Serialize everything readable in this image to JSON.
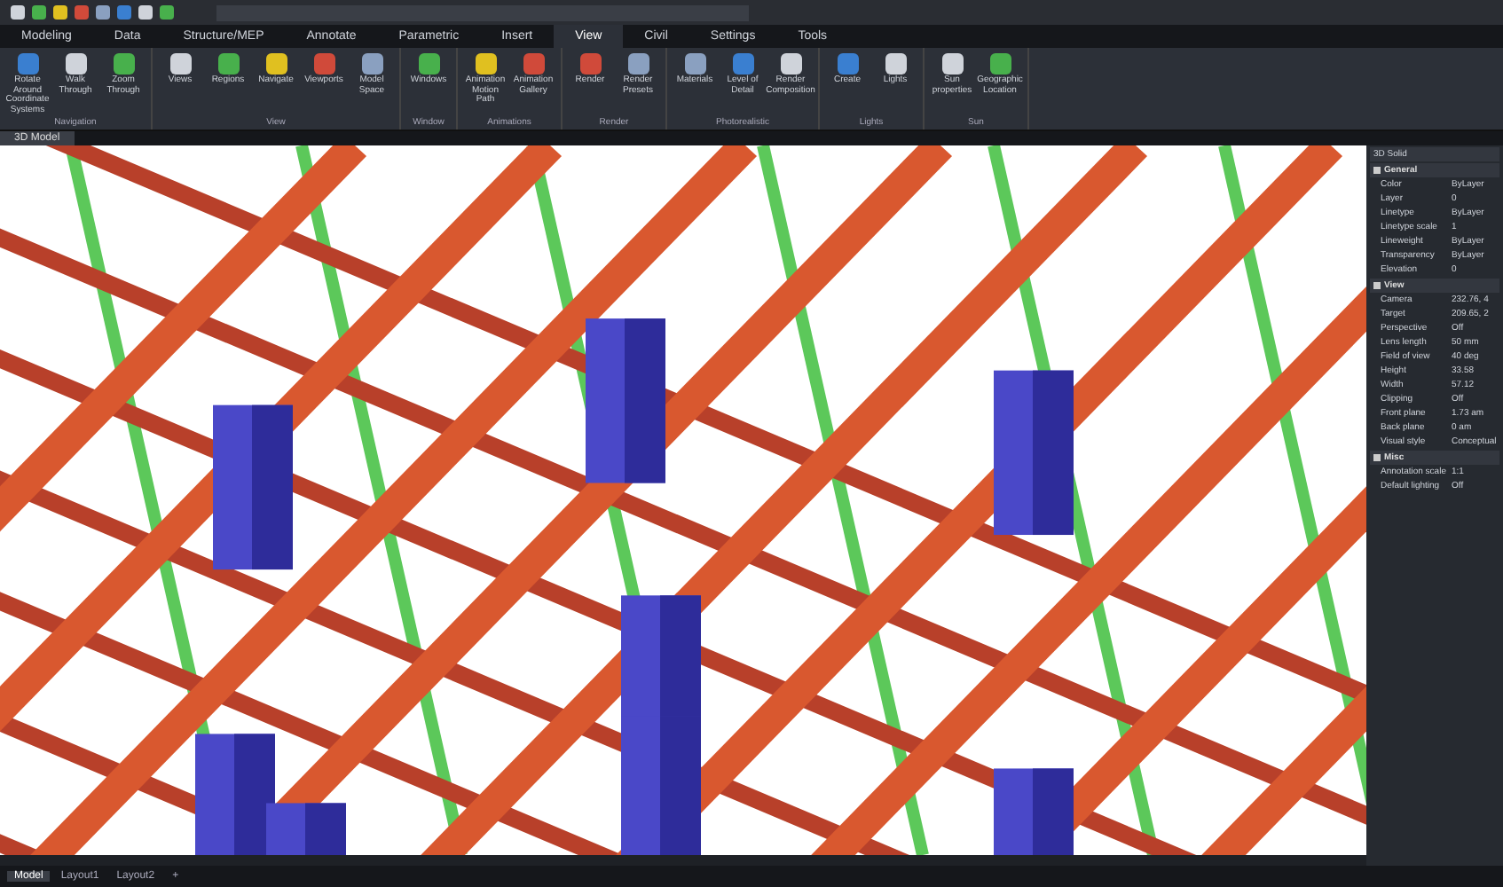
{
  "ribbon_tabs": [
    {
      "label": "Modeling",
      "selected": false
    },
    {
      "label": "Data",
      "selected": false
    },
    {
      "label": "Structure/MEP",
      "selected": false
    },
    {
      "label": "Annotate",
      "selected": false
    },
    {
      "label": "Parametric",
      "selected": false
    },
    {
      "label": "Insert",
      "selected": false
    },
    {
      "label": "View",
      "selected": true
    },
    {
      "label": "Civil",
      "selected": false
    },
    {
      "label": "Settings",
      "selected": false
    },
    {
      "label": "Tools",
      "selected": false
    }
  ],
  "ribbon_panels": [
    {
      "title": "Navigation",
      "buttons": [
        "Rotate Around Coordinate Systems",
        "Walk Through",
        "Zoom Through"
      ]
    },
    {
      "title": "View",
      "buttons": [
        "Views",
        "Regions",
        "Navigate",
        "Viewports",
        "Model Space"
      ]
    },
    {
      "title": "Window",
      "buttons": [
        "Windows"
      ]
    },
    {
      "title": "Animations",
      "buttons": [
        "Animation Motion Path",
        "Animation Gallery"
      ]
    },
    {
      "title": "Render",
      "buttons": [
        "Render",
        "Render Presets"
      ]
    },
    {
      "title": "Photorealistic",
      "buttons": [
        "Materials",
        "Level of Detail",
        "Render Composition"
      ]
    },
    {
      "title": "Lights",
      "buttons": [
        "Create",
        "Lights"
      ]
    },
    {
      "title": "Sun",
      "buttons": [
        "Sun properties",
        "Geographic Location"
      ]
    }
  ],
  "document_tab": "3D Model",
  "properties": {
    "title": "3D Solid",
    "sections": [
      {
        "title": "General",
        "expanded": true,
        "rows": [
          {
            "name": "Color",
            "value": "ByLayer"
          },
          {
            "name": "Layer",
            "value": "0"
          },
          {
            "name": "Linetype",
            "value": "ByLayer"
          },
          {
            "name": "Linetype scale",
            "value": "1"
          },
          {
            "name": "Lineweight",
            "value": "ByLayer"
          },
          {
            "name": "Transparency",
            "value": "ByLayer"
          },
          {
            "name": "Elevation",
            "value": "0"
          }
        ]
      },
      {
        "title": "View",
        "expanded": true,
        "rows": [
          {
            "name": "Camera",
            "value": "232.76, 4"
          },
          {
            "name": "Target",
            "value": "209.65, 2"
          },
          {
            "name": "Perspective",
            "value": "Off"
          },
          {
            "name": "Lens length",
            "value": "50 mm"
          },
          {
            "name": "Field of view",
            "value": "40 deg"
          },
          {
            "name": "Height",
            "value": "33.58"
          },
          {
            "name": "Width",
            "value": "57.12"
          },
          {
            "name": "Clipping",
            "value": "Off"
          },
          {
            "name": "Front plane",
            "value": "1.73 am"
          },
          {
            "name": "Back plane",
            "value": "0 am"
          },
          {
            "name": "Visual style",
            "value": "Conceptual"
          }
        ]
      },
      {
        "title": "Misc",
        "expanded": true,
        "rows": [
          {
            "name": "Annotation scale",
            "value": "1:1"
          },
          {
            "name": "Default lighting",
            "value": "Off"
          }
        ]
      }
    ]
  },
  "layout_tabs": [
    {
      "label": "Model",
      "selected": true
    },
    {
      "label": "Layout1",
      "selected": false
    },
    {
      "label": "Layout2",
      "selected": false
    },
    {
      "label": "+",
      "selected": false
    }
  ]
}
